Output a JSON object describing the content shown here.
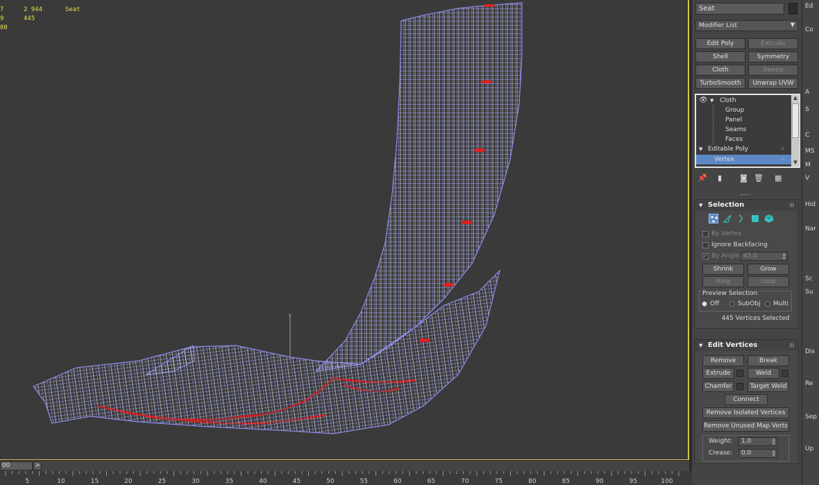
{
  "viewport": {
    "stats": [
      {
        "col1": "7",
        "col2": "2 944",
        "col3": "Seat"
      },
      {
        "col1": "9",
        "col2": "445",
        "col3": ""
      },
      {
        "col1": "",
        "col2": "",
        "col3": ""
      },
      {
        "col1": "80",
        "col2": "",
        "col3": ""
      }
    ],
    "axis_label": "z"
  },
  "timeline": {
    "slider_value": "00",
    "next_label": ">",
    "ruler_ticks": [
      "5",
      "10",
      "15",
      "20",
      "25",
      "30",
      "35",
      "40",
      "45",
      "50",
      "55",
      "60",
      "65",
      "70",
      "75",
      "80",
      "85",
      "90",
      "95",
      "100"
    ]
  },
  "panel": {
    "object_name": "Seat",
    "modifier_list": "Modifier List",
    "modifier_buttons": [
      {
        "label": "Edit Poly",
        "enabled": true
      },
      {
        "label": "Extrude",
        "enabled": false
      },
      {
        "label": "Shell",
        "enabled": true
      },
      {
        "label": "Symmetry",
        "enabled": true
      },
      {
        "label": "Cloth",
        "enabled": true
      },
      {
        "label": "Sweep",
        "enabled": false
      },
      {
        "label": "TurboSmooth",
        "enabled": true
      },
      {
        "label": "Unwrap UVW",
        "enabled": true
      }
    ],
    "stack": [
      {
        "label": "Cloth",
        "level": 0,
        "selected": false
      },
      {
        "label": "Group",
        "level": 1,
        "selected": false
      },
      {
        "label": "Panel",
        "level": 1,
        "selected": false
      },
      {
        "label": "Seams",
        "level": 1,
        "selected": false
      },
      {
        "label": "Faces",
        "level": 1,
        "selected": false
      },
      {
        "label": "Editable Poly",
        "level": 0,
        "selected": false
      },
      {
        "label": "Vertex",
        "level": 1,
        "selected": true
      }
    ],
    "selection": {
      "title": "Selection",
      "by_vertex": "By Vertex",
      "ignore_backfacing": "Ignore Backfacing",
      "by_angle": "By Angle:",
      "angle_value": "45,0",
      "shrink": "Shrink",
      "grow": "Grow",
      "ring": "Ring",
      "loop": "Loop",
      "preview_title": "Preview Selection",
      "preview_options": [
        "Off",
        "SubObj",
        "Multi"
      ],
      "status": "445 Vertices Selected"
    },
    "edit_vertices": {
      "title": "Edit Vertices",
      "remove": "Remove",
      "break": "Break",
      "extrude": "Extrude",
      "weld": "Weld",
      "chamfer": "Chamfer",
      "target_weld": "Target Weld",
      "connect": "Connect",
      "remove_isolated": "Remove Isolated Vertices",
      "remove_unused": "Remove Unused Map Verts",
      "weight_label": "Weight:",
      "weight_value": "1,0",
      "crease_label": "Crease:",
      "crease_value": "0,0"
    }
  },
  "strip": {
    "labels": [
      "Ed",
      "Co",
      "A",
      "S",
      "C",
      "MS",
      "M",
      "V",
      "Hid",
      "Nar",
      "Sc",
      "Su",
      "Dis",
      "Re",
      "Sep",
      "Up"
    ]
  },
  "colors": {
    "viewport_bg": "#3a3a3a",
    "wire": "#8c8cf0",
    "wire_light": "#e6e6f0",
    "selected_vertex": "#e02020",
    "stat_text": "#e5e04a",
    "selection_highlight": "#5c87c4"
  }
}
